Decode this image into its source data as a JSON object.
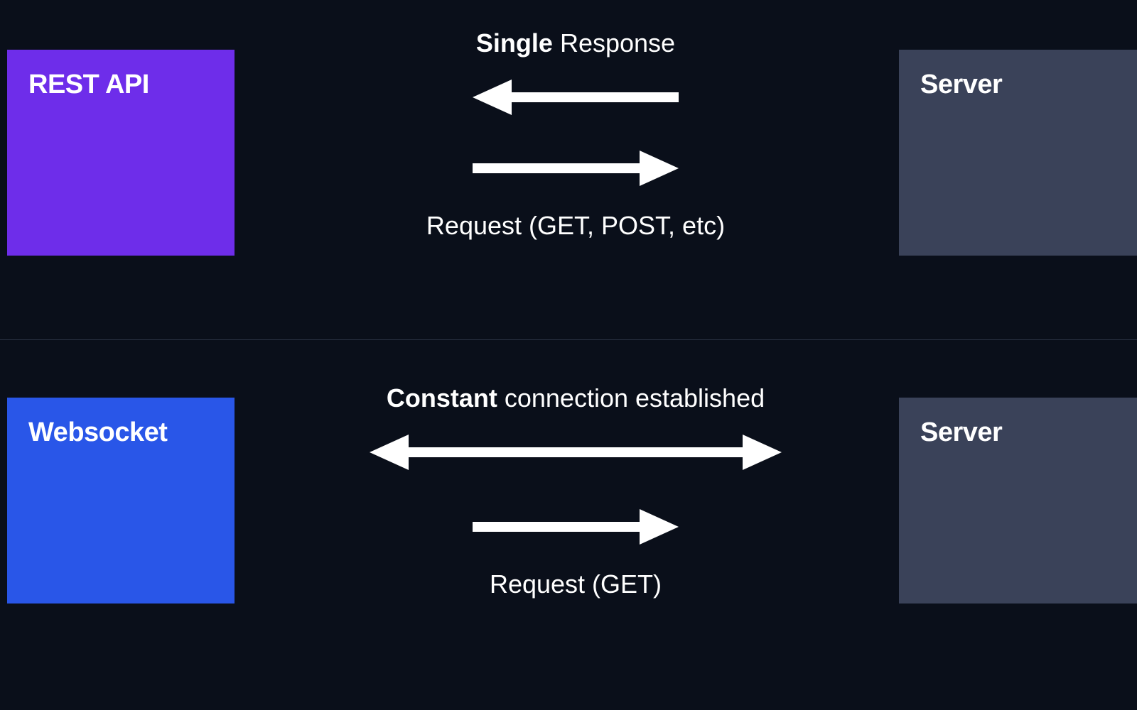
{
  "top": {
    "leftBox": "REST API",
    "rightBox": "Server",
    "topLabelBold": "Single",
    "topLabelRest": " Response",
    "bottomLabel": "Request (GET, POST, etc)"
  },
  "bottom": {
    "leftBox": "Websocket",
    "rightBox": "Server",
    "topLabelBold": "Constant",
    "topLabelRest": " connection established",
    "bottomLabel": "Request (GET)"
  }
}
